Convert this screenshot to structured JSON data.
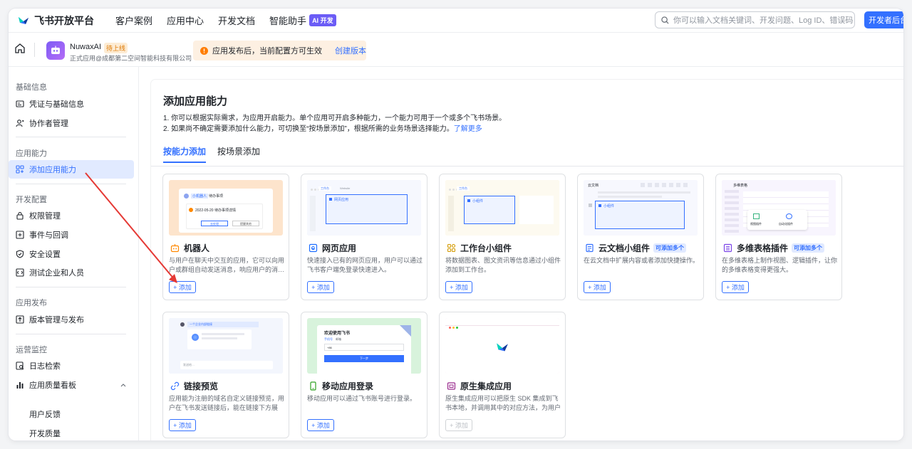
{
  "topbar": {
    "brand": "飞书开放平台",
    "nav": [
      "客户案例",
      "应用中心",
      "开发文档",
      "智能助手"
    ],
    "ai_badge": "AI 开发",
    "search_placeholder": "你可以输入文档关键词、开发问题、Log ID、错误码",
    "dev_button": "开发者后台"
  },
  "app": {
    "name": "NuwaxAI",
    "status": "待上线",
    "company": "正式应用@成都第二空间智能科技有限公司",
    "notice": "应用发布后，当前配置方可生效",
    "notice_link": "创建版本"
  },
  "sidebar": {
    "groups": [
      "基础信息",
      "应用能力",
      "开发配置",
      "应用发布",
      "运营监控"
    ],
    "items": [
      "凭证与基础信息",
      "协作者管理",
      "添加应用能力",
      "权限管理",
      "事件与回调",
      "安全设置",
      "测试企业和人员",
      "版本管理与发布",
      "日志检索",
      "应用质量看板"
    ],
    "sub_items": [
      "用户反馈",
      "开发质量"
    ]
  },
  "main": {
    "title": "添加应用能力",
    "desc1": "1. 你可以根据实际需求，为应用开启能力。单个应用可开启多种能力，一个能力可用于一个或多个飞书场景。",
    "desc2": "2. 如果尚不确定需要添加什么能力，可切换至“按场景添加”，根据所需的业务场景选择能力。",
    "desc2_link": "了解更多",
    "tabs": [
      "按能力添加",
      "按场景添加"
    ]
  },
  "add_label": "+ 添加",
  "multi_badge": "可添加多个",
  "cards": [
    {
      "title": "机器人",
      "desc": "与用户在聊天中交互的应用，它可以向用户或群组自动发送消息，响应用户的消…",
      "icon": "robot-icon"
    },
    {
      "title": "网页应用",
      "desc": "快速接入已有的网页应用，用户可以通过飞书客户端免登录快速进入。",
      "icon": "web-icon"
    },
    {
      "title": "工作台小组件",
      "desc": "将数据图表、图文资讯等信息通过小组件添加到工作台。",
      "icon": "widget-icon"
    },
    {
      "title": "云文档小组件",
      "desc": "在云文档中扩展内容或者添加快捷操作。",
      "icon": "doc-icon"
    },
    {
      "title": "多维表格插件",
      "desc": "在多维表格上制作视图、逻辑插件，让你的多维表格变得更强大。",
      "icon": "table-icon"
    },
    {
      "title": "链接预览",
      "desc": "应用能为注册的域名自定义链接预览，用户在飞书发送链接后，能在链接下方展示…",
      "icon": "link-icon"
    },
    {
      "title": "移动应用登录",
      "desc": "移动应用可以通过飞书账号进行登录。",
      "icon": "mobile-icon"
    },
    {
      "title": "原生集成应用",
      "desc": "原生集成应用可以把原生 SDK 集成到飞书本地，并调用其中的对应方法，为用户提…",
      "icon": "native-icon"
    }
  ],
  "thumb_text": {
    "robot_tag": "小机器人",
    "robot_msg": "待办事项",
    "robot_date": "2022-05-20 待办事项详情",
    "robot_btn1": "去处理",
    "robot_btn2": "提醒其他",
    "web_tab1": "工作台",
    "web_tab2": "Website",
    "web_label": "网页应用",
    "widget_tab": "工作台",
    "widget_label": "小组件",
    "doc_back": "云文档",
    "doc_label": "小组件",
    "table_title": "多维表格",
    "table_plugin1": "视图插件",
    "table_plugin2": "自动化插件",
    "link_msg": "一个企业内部链接",
    "link_input": "发送给…",
    "mobile_title": "欢迎使用飞书",
    "mobile_tab1": "手机号",
    "mobile_tab2": "邮箱",
    "mobile_code": "+86",
    "mobile_btn": "下一步"
  },
  "colors": {
    "accent": "#3370ff",
    "arrow": "#e53935"
  }
}
